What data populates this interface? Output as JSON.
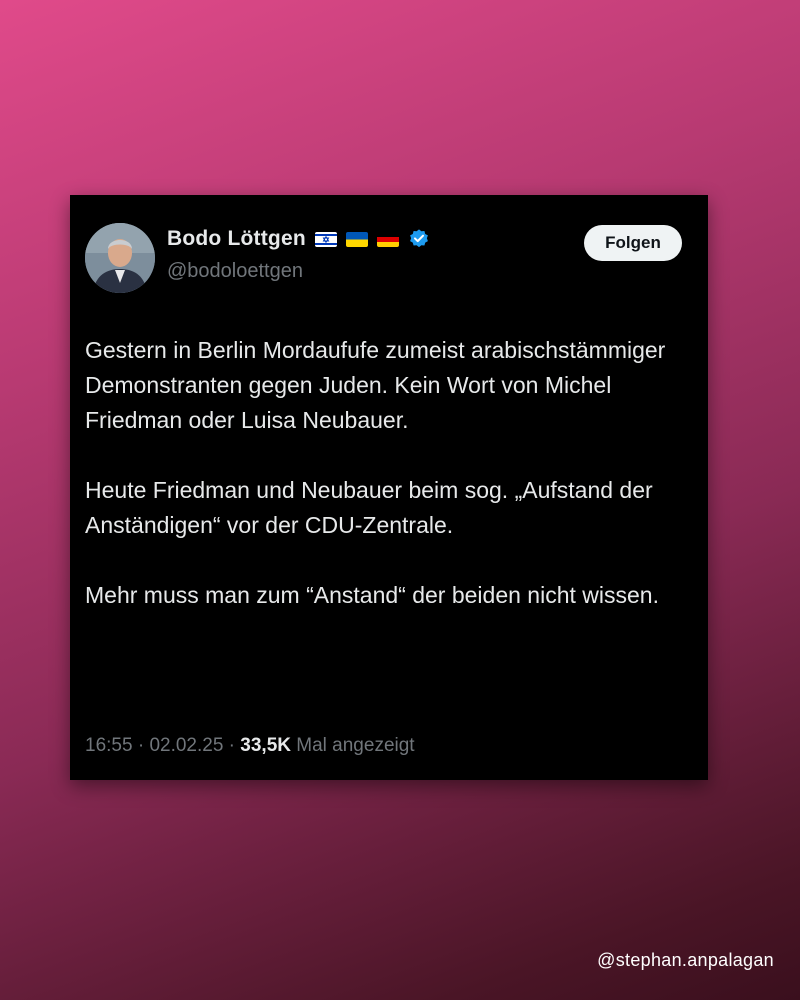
{
  "tweet": {
    "author": {
      "display_name": "Bodo Löttgen",
      "handle": "@bodoloettgen",
      "flags": [
        "israel-flag-icon",
        "ukraine-flag-icon",
        "germany-flag-icon"
      ],
      "verified": true
    },
    "follow_label": "Folgen",
    "paragraphs": [
      "Gestern in Berlin Mordaufufe zumeist arabischstämmiger Demonstranten gegen Juden. Kein Wort von Michel Friedman oder Luisa Neubauer.",
      "Heute Friedman und Neubauer beim sog. „Aufstand der Anständigen“ vor der CDU-Zentrale.",
      "Mehr muss man zum “Anstand“ der beiden nicht wissen."
    ],
    "time": "16:55",
    "separator": " · ",
    "date": "02.02.25",
    "views_count": "33,5K",
    "views_label": "Mal angezeigt"
  },
  "watermark": "@stephan.anpalagan",
  "colors": {
    "card_background": "#000000",
    "text_primary": "#e7e9ea",
    "text_secondary": "#71767b",
    "verified_badge": "#1d9bf0",
    "follow_button_bg": "#eff3f4"
  }
}
